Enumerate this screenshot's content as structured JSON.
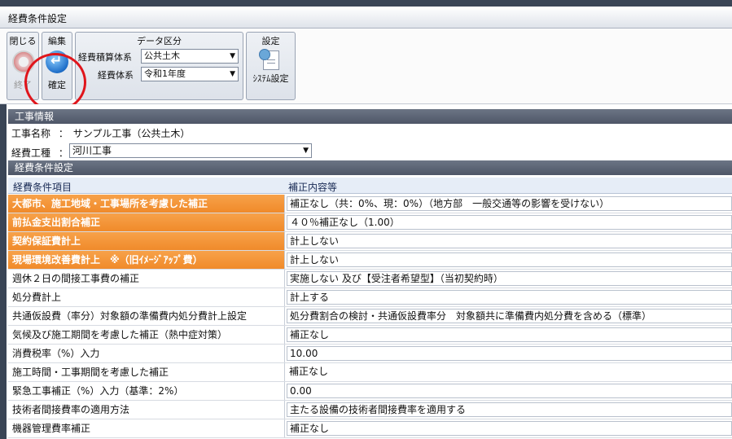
{
  "window": {
    "title": "経費条件設定"
  },
  "toolbar": {
    "close_group": {
      "title": "閉じる",
      "button_label": "終了"
    },
    "edit_group": {
      "title": "編集",
      "button_label": "確定"
    },
    "data_group": {
      "title": "データ区分",
      "system_label": "経費積算体系",
      "system_value": "公共土木",
      "expense_label": "経費体系",
      "expense_value": "令和1年度"
    },
    "settings_group": {
      "title": "設定",
      "button_label": "ｼｽﾃﾑ設定"
    }
  },
  "project_info": {
    "header": "工事情報",
    "name_label": "工事名称",
    "name_value": "サンプル工事（公共土木）",
    "type_label": "経費工種",
    "type_value": "河川工事",
    "colon": "："
  },
  "conditions": {
    "header": "経費条件設定",
    "col_item": "経費条件項目",
    "col_content": "補正内容等",
    "rows": [
      {
        "item": "大都市、施工地域・工事場所を考慮した補正",
        "value": "補正なし（共：0%、現：0%）（地方部　一般交通等の影響を受けない）",
        "highlight": true
      },
      {
        "item": "前払金支出割合補正",
        "value": "４０％補正なし（1.00）",
        "highlight": true
      },
      {
        "item": "契約保証費計上",
        "value": "計上しない",
        "highlight": true
      },
      {
        "item": "現場環境改善費計上　※（旧ｲﾒｰｼﾞｱｯﾌﾟ費）",
        "value": "計上しない",
        "highlight": true
      },
      {
        "item": "週休２日の間接工事費の補正",
        "value": "実施しない 及び【受注者希望型】（当初契約時）",
        "highlight": false
      },
      {
        "item": "処分費計上",
        "value": "計上する",
        "highlight": false
      },
      {
        "item": "共通仮設費（率分）対象額の準備費内処分費計上設定",
        "value": "処分費割合の検討・共通仮設費率分　対象額共に準備費内処分費を含める（標準）",
        "highlight": false
      },
      {
        "item": "気候及び施工期間を考慮した補正（熱中症対策）",
        "value": "補正なし",
        "highlight": false
      },
      {
        "item": "消費税率（%）入力",
        "value": "10.00",
        "highlight": false
      },
      {
        "item": "施工時間・工事期間を考慮した補正",
        "value": "補正なし",
        "highlight": false,
        "plain": true
      },
      {
        "item": "緊急工事補正（%）入力（基準：2%）",
        "value": "0.00",
        "highlight": false
      },
      {
        "item": "技術者間接費率の適用方法",
        "value": "主たる設備の技術者間接費率を適用する",
        "highlight": false
      },
      {
        "item": "機器管理費率補正",
        "value": "補正なし",
        "highlight": false
      }
    ]
  },
  "colors": {
    "accent_orange": "#f08a2a",
    "annotation_red": "#e0151b",
    "header_dark": "#4e5667"
  },
  "icons": {
    "close": "close-circle-icon",
    "confirm": "enter-arrow-icon",
    "settings": "settings-document-icon"
  }
}
